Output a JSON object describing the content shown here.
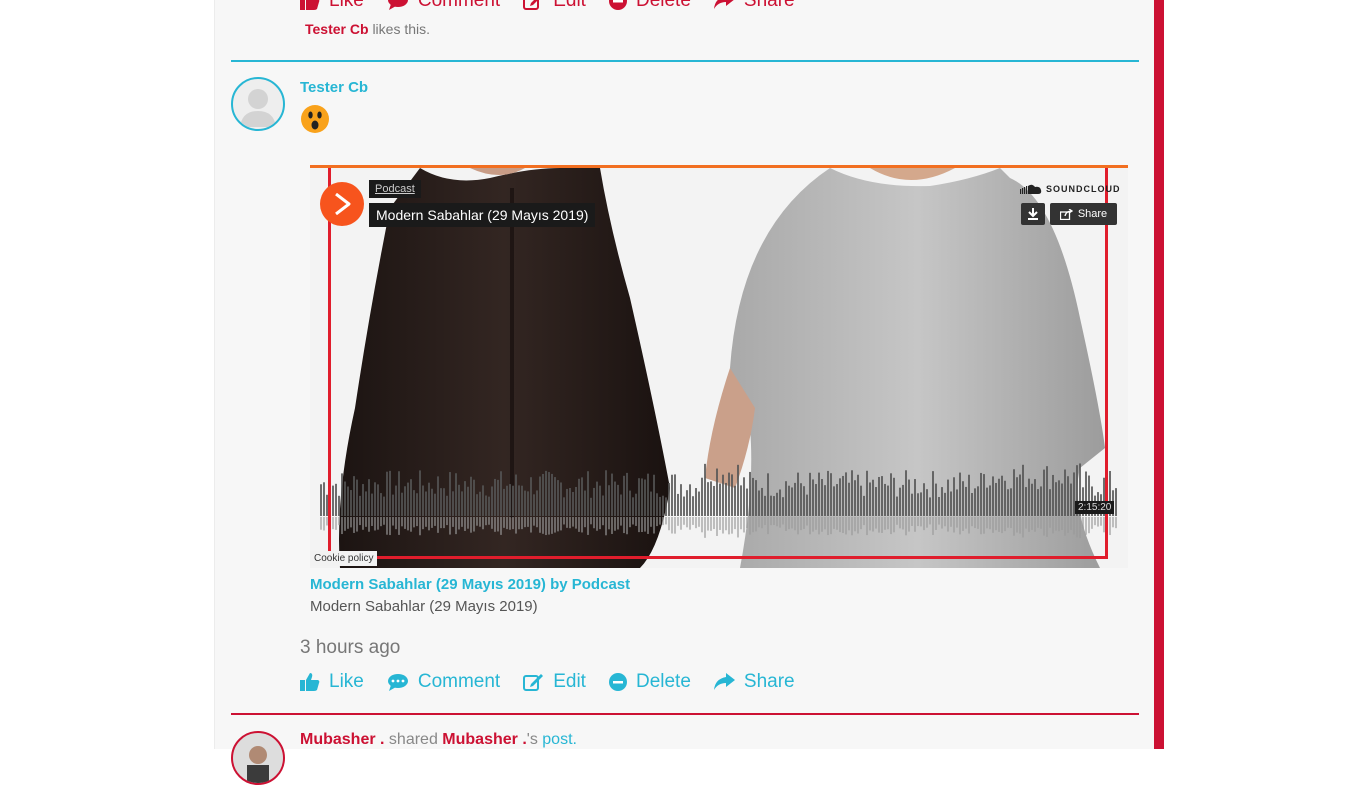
{
  "colors": {
    "brand_red": "#cc1133",
    "accent_blue": "#27b6d4",
    "soundcloud_orange": "#f7541d"
  },
  "prev_post": {
    "actions": {
      "like": "Like",
      "comment": "Comment",
      "edit": "Edit",
      "delete": "Delete",
      "share": "Share"
    },
    "liked_by": "Tester Cb",
    "likes_suffix": "likes this."
  },
  "post": {
    "author": "Tester Cb",
    "reaction_icon": "surprised-face-icon",
    "embed": {
      "user": "Podcast",
      "title": "Modern Sabahlar (29 Mayıs 2019)",
      "brand": "SOUNDCLOUD",
      "share_label": "Share",
      "duration": "2:15:20",
      "cookie_policy": "Cookie policy"
    },
    "link_title": "Modern Sabahlar (29 Mayıs 2019) by Podcast",
    "link_description": "Modern Sabahlar (29 Mayıs 2019)",
    "timestamp": "3 hours ago",
    "actions": {
      "like": "Like",
      "comment": "Comment",
      "edit": "Edit",
      "delete": "Delete",
      "share": "Share"
    }
  },
  "next_post": {
    "author": "Mubasher .",
    "shared": "shared",
    "owner": "Mubasher .",
    "possessive": "'s",
    "post_link": "post."
  }
}
